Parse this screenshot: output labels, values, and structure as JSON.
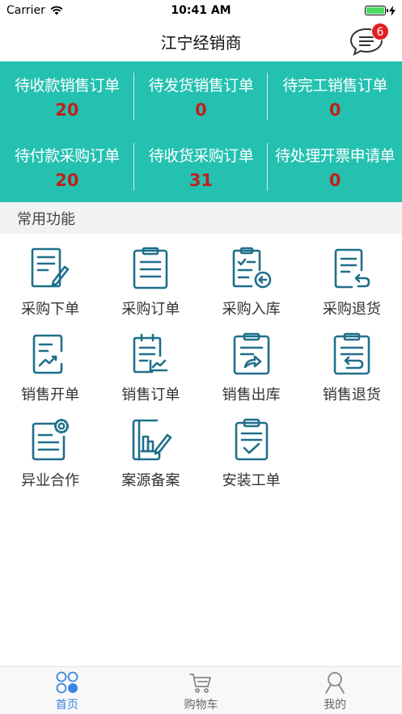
{
  "status": {
    "carrier": "Carrier",
    "time": "10:41 AM"
  },
  "nav": {
    "title": "江宁经销商",
    "badge": "6"
  },
  "stats": [
    {
      "label": "待收款销售订单",
      "value": "20"
    },
    {
      "label": "待发货销售订单",
      "value": "0"
    },
    {
      "label": "待完工销售订单",
      "value": "0"
    },
    {
      "label": "待付款采购订单",
      "value": "20"
    },
    {
      "label": "待收货采购订单",
      "value": "31"
    },
    {
      "label": "待处理开票申请单",
      "value": "0"
    }
  ],
  "section": {
    "title": "常用功能"
  },
  "functions": [
    {
      "label": "采购下单",
      "icon": "purchase-order-create-icon"
    },
    {
      "label": "采购订单",
      "icon": "purchase-order-list-icon"
    },
    {
      "label": "采购入库",
      "icon": "purchase-inbound-icon"
    },
    {
      "label": "采购退货",
      "icon": "purchase-return-icon"
    },
    {
      "label": "销售开单",
      "icon": "sales-create-icon"
    },
    {
      "label": "销售订单",
      "icon": "sales-order-icon"
    },
    {
      "label": "销售出库",
      "icon": "sales-outbound-icon"
    },
    {
      "label": "销售退货",
      "icon": "sales-return-icon"
    },
    {
      "label": "异业合作",
      "icon": "cross-industry-icon"
    },
    {
      "label": "案源备案",
      "icon": "case-filing-icon"
    },
    {
      "label": "安装工单",
      "icon": "install-order-icon"
    }
  ],
  "tabs": [
    {
      "label": "首页",
      "icon": "home-grid-icon",
      "active": true
    },
    {
      "label": "购物车",
      "icon": "cart-icon",
      "active": false
    },
    {
      "label": "我的",
      "icon": "profile-icon",
      "active": false
    }
  ],
  "colors": {
    "accent": "#24c1b1",
    "value_red": "#c0201c",
    "icon_blue": "#1f6f8b",
    "tab_active": "#3b86e0"
  }
}
